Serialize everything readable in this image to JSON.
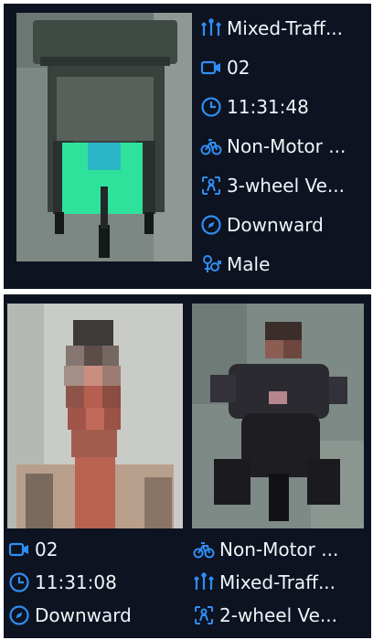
{
  "colors": {
    "panel_bg": "#0d1320",
    "icon_blue": "#2f8ef4",
    "text": "#f1f4f8"
  },
  "top_record": {
    "thumbnail": "non-motor-vehicle-snapshot",
    "attributes": [
      {
        "icon": "mixed-traffic-icon",
        "text": "Mixed-Traff..."
      },
      {
        "icon": "camera-icon",
        "text": "02"
      },
      {
        "icon": "clock-icon",
        "text": "11:31:48"
      },
      {
        "icon": "bicycle-icon",
        "text": "Non-Motor ..."
      },
      {
        "icon": "vehicle-type-icon",
        "text": "3-wheel Ve..."
      },
      {
        "icon": "direction-icon",
        "text": "Downward"
      },
      {
        "icon": "gender-icon",
        "text": "Male"
      }
    ]
  },
  "bottom_record": {
    "left_thumbnail": "face-snapshot-pixelated",
    "right_thumbnail": "rider-snapshot-pixelated",
    "left_attributes": [
      {
        "icon": "camera-icon",
        "text": "02"
      },
      {
        "icon": "clock-icon",
        "text": "11:31:08"
      },
      {
        "icon": "direction-icon",
        "text": "Downward"
      }
    ],
    "right_attributes": [
      {
        "icon": "bicycle-icon",
        "text": "Non-Motor ..."
      },
      {
        "icon": "mixed-traffic-icon",
        "text": "Mixed-Traff..."
      },
      {
        "icon": "vehicle-type-icon",
        "text": "2-wheel Ve..."
      }
    ]
  }
}
